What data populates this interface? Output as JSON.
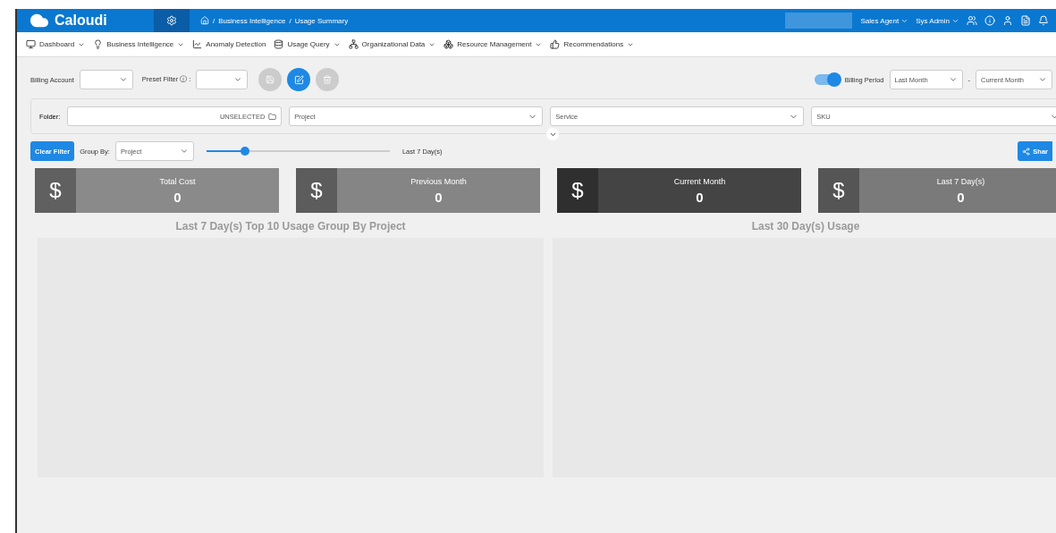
{
  "header": {
    "logo": "Caloudi",
    "breadcrumb": [
      {
        "sep": "/",
        "label": "Business Intelligence"
      },
      {
        "sep": "/",
        "label": "Usage Summary"
      }
    ],
    "user_menus": [
      "Sales Agent",
      "Sys Admin"
    ]
  },
  "nav": [
    {
      "label": "Dashboard",
      "dropdown": true
    },
    {
      "label": "Business Intelligence",
      "dropdown": true
    },
    {
      "label": "Anomaly Detection",
      "dropdown": false
    },
    {
      "label": "Usage Query",
      "dropdown": true
    },
    {
      "label": "Organizational Data",
      "dropdown": true
    },
    {
      "label": "Resource Management",
      "dropdown": true
    },
    {
      "label": "Recommendations",
      "dropdown": true
    }
  ],
  "filters": {
    "billing_account": "Billing Account",
    "preset_filter": "Preset Filter ⓘ :",
    "billing_period_on": true,
    "billing_period": "Billing Period",
    "period_from": "Last Month",
    "period_sep": "-",
    "period_to": "Current Month"
  },
  "folder": {
    "label": "Folder:",
    "value": "UNSELECTED",
    "selects": [
      "Project",
      "Service",
      "SKU"
    ]
  },
  "controls": {
    "clear": "Clear Filter",
    "group_label": "Group By:",
    "group_value": "Project",
    "range": {
      "level": 0.21
    },
    "range_label": "Last 7 Day(s)",
    "share": "Shar"
  },
  "cards": [
    {
      "icon": "$",
      "title": "Total Cost",
      "value": "0",
      "color": "#8a8a8a"
    },
    {
      "icon": "$",
      "title": "Previous Month",
      "value": "0",
      "color": "#858585"
    },
    {
      "icon": "$",
      "title": "Current Month",
      "value": "0",
      "color": "#444444"
    },
    {
      "icon": "$",
      "title": "Last 7 Day(s)",
      "value": "0",
      "color": "#7a7a7a"
    }
  ],
  "charts": [
    {
      "title": "Last 7 Day(s) Top 10 Usage Group By Project"
    },
    {
      "title": "Last 30 Day(s) Usage"
    }
  ]
}
